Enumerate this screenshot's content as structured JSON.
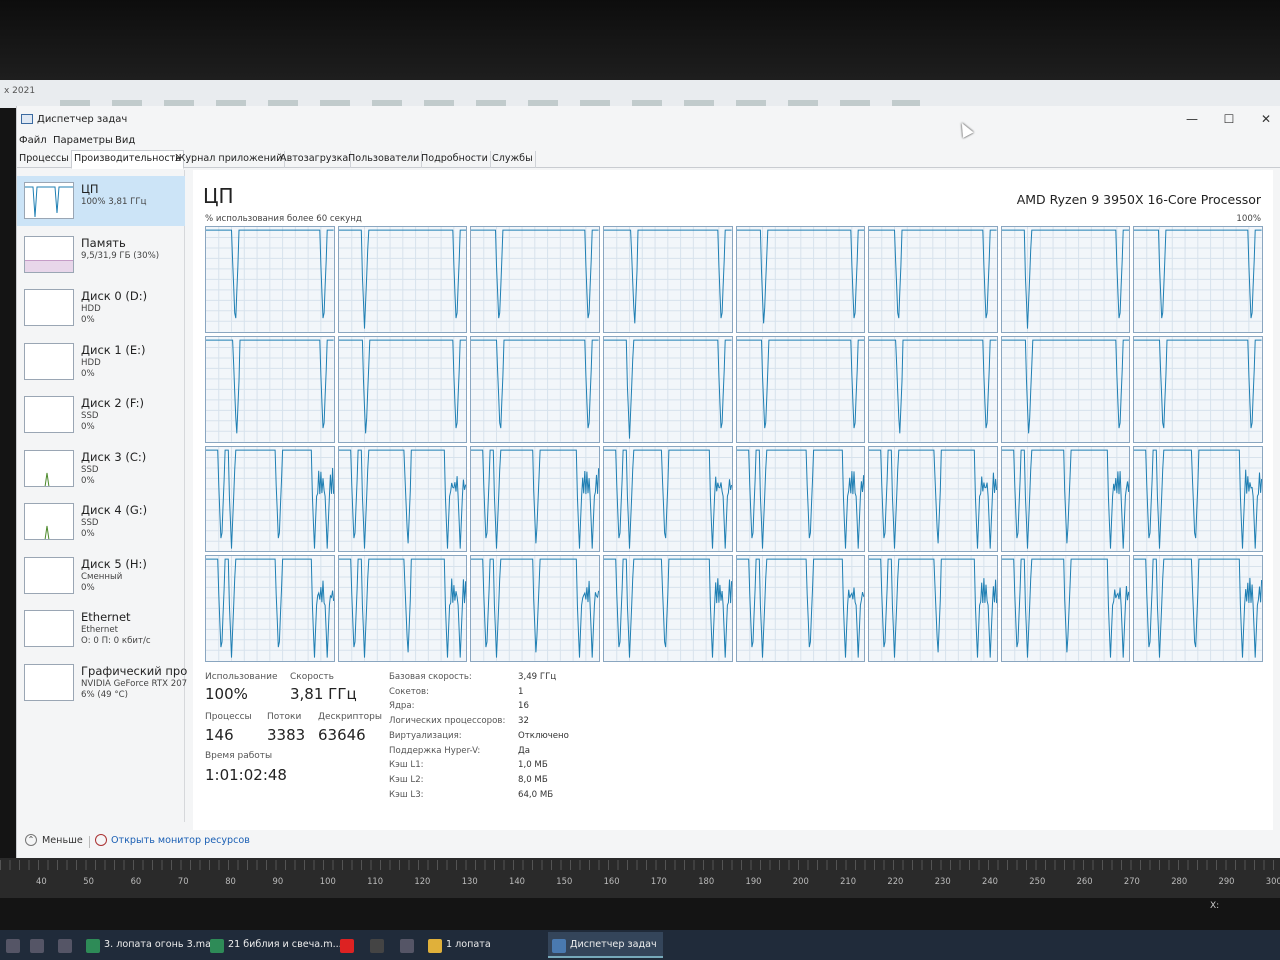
{
  "background": {
    "year_fragment": "x 2021"
  },
  "window": {
    "title": "Диспетчер задач",
    "controls": [
      "—",
      "☐",
      "✕"
    ]
  },
  "menu": [
    "Файл",
    "Параметры",
    "Вид"
  ],
  "tabs": [
    {
      "label": "Процессы"
    },
    {
      "label": "Производительность",
      "active": true
    },
    {
      "label": "Журнал приложений"
    },
    {
      "label": "Автозагрузка"
    },
    {
      "label": "Пользователи"
    },
    {
      "label": "Подробности"
    },
    {
      "label": "Службы"
    }
  ],
  "sidebar": [
    {
      "name": "ЦП",
      "line2": "100% 3,81 ГГц",
      "line3": "",
      "active": true,
      "icon": "cpu-graph-icon"
    },
    {
      "name": "Память",
      "line2": "9,5/31,9 ГБ (30%)",
      "line3": "",
      "icon": "memory-graph-icon"
    },
    {
      "name": "Диск 0 (D:)",
      "line2": "HDD",
      "line3": "0%",
      "icon": "disk-graph-icon"
    },
    {
      "name": "Диск 1 (E:)",
      "line2": "HDD",
      "line3": "0%",
      "icon": "disk-graph-icon"
    },
    {
      "name": "Диск 2 (F:)",
      "line2": "SSD",
      "line3": "0%",
      "icon": "disk-graph-icon"
    },
    {
      "name": "Диск 3 (C:)",
      "line2": "SSD",
      "line3": "0%",
      "icon": "disk-graph-icon"
    },
    {
      "name": "Диск 4 (G:)",
      "line2": "SSD",
      "line3": "0%",
      "icon": "disk-graph-icon"
    },
    {
      "name": "Диск 5 (H:)",
      "line2": "Сменный",
      "line3": "0%",
      "icon": "disk-graph-icon"
    },
    {
      "name": "Ethernet",
      "line2": "Ethernet",
      "line3": "О: 0 П: 0 кбит/с",
      "icon": "network-graph-icon"
    },
    {
      "name": "Графический про",
      "line2": "NVIDIA GeForce RTX 207",
      "line3": "6% (49 °C)",
      "icon": "gpu-graph-icon"
    }
  ],
  "cpu": {
    "title": "ЦП",
    "model": "AMD Ryzen 9 3950X 16-Core Processor",
    "util_label": "% использования более 60 секунд",
    "util_max": "100%",
    "logical_cores": 32
  },
  "stats": {
    "usage_label": "Использование",
    "usage_value": "100%",
    "speed_label": "Скорость",
    "speed_value": "3,81 ГГц",
    "processes_label": "Процессы",
    "processes_value": "146",
    "threads_label": "Потоки",
    "threads_value": "3383",
    "handles_label": "Дескрипторы",
    "handles_value": "63646",
    "uptime_label": "Время работы",
    "uptime_value": "1:01:02:48"
  },
  "details": [
    {
      "label": "Базовая скорость:",
      "value": "3,49 ГГц"
    },
    {
      "label": "Сокетов:",
      "value": "1"
    },
    {
      "label": "Ядра:",
      "value": "16"
    },
    {
      "label": "Логических процессоров:",
      "value": "32"
    },
    {
      "label": "Виртуализация:",
      "value": "Отключено"
    },
    {
      "label": "Поддержка Hyper-V:",
      "value": "Да"
    },
    {
      "label": "Кэш L1:",
      "value": "1,0 МБ"
    },
    {
      "label": "Кэш L2:",
      "value": "8,0 МБ"
    },
    {
      "label": "Кэш L3:",
      "value": "64,0 МБ"
    }
  ],
  "bottom": {
    "less_label": "Меньше",
    "monitor_link": "Открыть монитор ресурсов"
  },
  "ruler_ticks": [
    "40",
    "50",
    "60",
    "70",
    "80",
    "90",
    "100",
    "110",
    "120",
    "130",
    "140",
    "150",
    "160",
    "170",
    "180",
    "190",
    "200",
    "210",
    "220",
    "230",
    "240",
    "250",
    "260",
    "270",
    "280",
    "290",
    "300"
  ],
  "ruler_x_label": "X:",
  "taskbar": [
    {
      "label": "",
      "icon": "app-icon"
    },
    {
      "label": "",
      "icon": "app-icon"
    },
    {
      "label": "",
      "icon": "app-icon"
    },
    {
      "label": "3. лопата огонь 3.ma...",
      "icon": "sheet-icon"
    },
    {
      "label": "21 библия и свеча.m...",
      "icon": "sheet-icon"
    },
    {
      "label": "",
      "icon": "opera-icon"
    },
    {
      "label": "",
      "icon": "calculator-icon"
    },
    {
      "label": "",
      "icon": "app-icon"
    },
    {
      "label": "1 лопата",
      "icon": "folder-icon"
    },
    {
      "label": "Диспетчер задач",
      "icon": "task-manager-icon",
      "open": true
    }
  ],
  "colors": {
    "graph_line": "#1f7fb3",
    "graph_bg": "#f2f6fa",
    "graph_border": "#8aa6c0",
    "selected": "#cce4f7",
    "link": "#1a5fb4"
  }
}
